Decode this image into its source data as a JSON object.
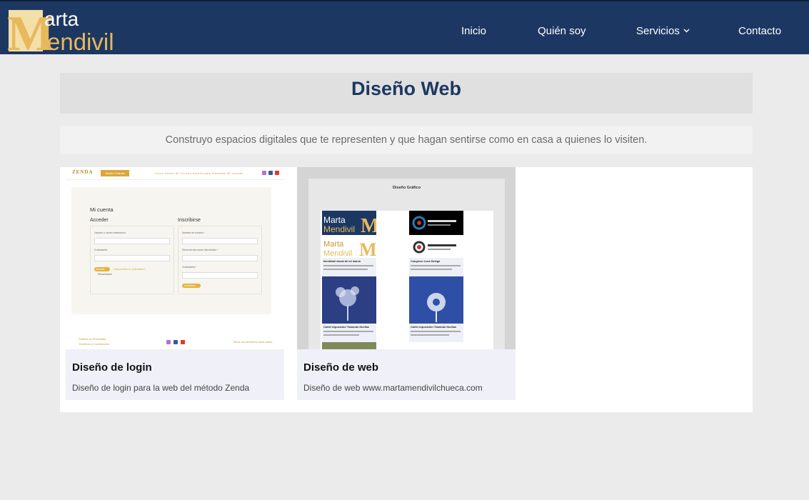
{
  "brand": {
    "logo_text_top": "arta",
    "logo_text_bottom": "endivil",
    "logo_letter": "M",
    "gold": "#e8b85c",
    "navy": "#1c3862"
  },
  "nav": {
    "items": [
      {
        "label": "Inicio"
      },
      {
        "label": "Quién soy"
      },
      {
        "label": "Servicios"
      },
      {
        "label": "Contacto"
      }
    ]
  },
  "page": {
    "title": "Diseño Web",
    "subtitle": "Construyo espacios digitales que te representen y que hagan sentirse como en casa a quienes lo visiten."
  },
  "gallery": {
    "cards": [
      {
        "title": "Diseño de login",
        "description": "Diseño de login para la web del método Zenda",
        "thumb": {
          "logo": "ZENDA",
          "button": "Sesión Gratuita",
          "menu": "Inicio   Sobre Mi   Cursos   Autoterapia   Reseñas   Mi cuenta",
          "heading": "Mi cuenta",
          "login": "Acceder",
          "register": "Inscribirse",
          "user_label": "Usuario o correo electrónico",
          "password_label": "Contraseña",
          "remember": "Recuérdame",
          "lost": "¿Has perdido tu contraseña?",
          "reg_user": "Nombre de usuario *",
          "reg_email": "Dirección de correo electrónico *",
          "reg_pass": "Contraseña *",
          "login_btn": "Acceder",
          "register_btn": "Inscribirse",
          "privacy": "Política de Privacidad",
          "terms": "Términos y Condiciones",
          "rights": "Todos los derechos reservados"
        }
      },
      {
        "title": "Diseño de web",
        "description": "Diseño de web www.martamendivilchueca.com",
        "thumb": {
          "heading": "Diseño Gráfico",
          "item1": "Identidad visual de mi marca",
          "item2": "Congreso Luca Design",
          "item3": "Cartel exposición Trazando Huellas",
          "item4": "Cartel exposición Trazando Huellas"
        }
      }
    ]
  }
}
